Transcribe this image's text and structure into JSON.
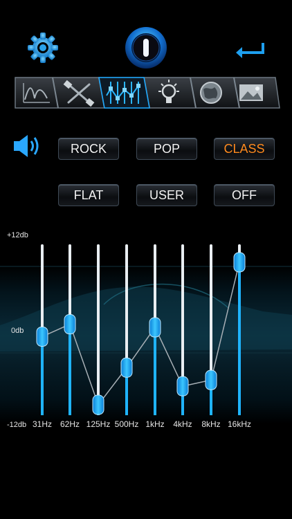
{
  "presets": {
    "speaker_icon": "speaker-icon",
    "row1": [
      "ROCK",
      "POP",
      "CLASS"
    ],
    "row2": [
      "FLAT",
      "USER",
      "OFF"
    ],
    "active": "CLASS",
    "active_color": "#ff8a1e"
  },
  "tabs": [
    "spectrum-tab-icon",
    "crossover-tab-icon",
    "equalizer-tab-icon",
    "light-tab-icon",
    "globe-tab-icon",
    "image-tab-icon"
  ],
  "active_tab": "equalizer-tab-icon",
  "eq": {
    "db_labels": {
      "top": "+12db",
      "mid": "0db",
      "bottom": "-12db"
    },
    "bands": [
      {
        "label": "31Hz",
        "db": -1
      },
      {
        "label": "62Hz",
        "db": 1
      },
      {
        "label": "125Hz",
        "db": -12
      },
      {
        "label": "500Hz",
        "db": -6
      },
      {
        "label": "1kHz",
        "db": 0.5
      },
      {
        "label": "4kHz",
        "db": -9
      },
      {
        "label": "8kHz",
        "db": -8
      },
      {
        "label": "16kHz",
        "db": 11
      }
    ],
    "accent_color": "#1fb4ff"
  }
}
